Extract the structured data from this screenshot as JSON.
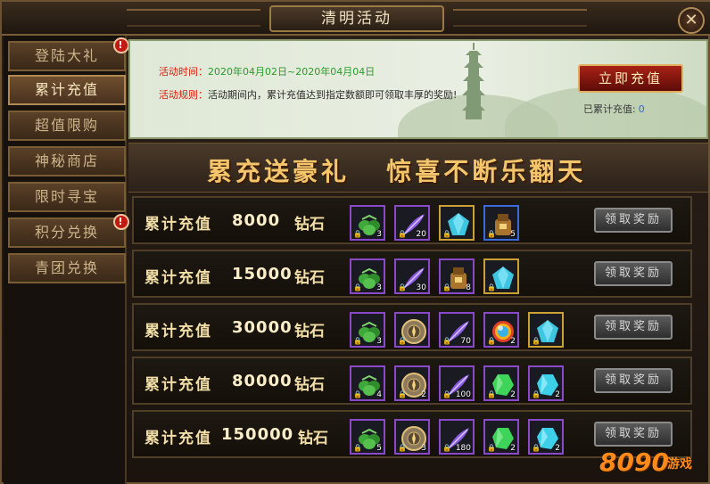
{
  "window": {
    "title": "清明活动",
    "close_label": "✕"
  },
  "sidebar": {
    "tabs": [
      {
        "label": "登陆大礼",
        "alert": "!"
      },
      {
        "label": "累计充值",
        "active": true
      },
      {
        "label": "超值限购"
      },
      {
        "label": "神秘商店"
      },
      {
        "label": "限时寻宝"
      },
      {
        "label": "积分兑换",
        "alert": "!"
      },
      {
        "label": "青团兑换"
      }
    ]
  },
  "banner": {
    "time_label": "活动时间：",
    "time_value": "2020年04月02日~2020年04月04日",
    "rule_label": "活动规则：",
    "rule_value": "活动期间内，累计充值达到指定数额即可领取丰厚的奖励!",
    "recharge_button": "立即充值",
    "total_label": "已累计充值:",
    "total_value": "0"
  },
  "slogan": "累充送豪礼   惊喜不断乐翻天",
  "rewards": [
    {
      "label": "累计充值",
      "amount": "8000",
      "unit": "钻石",
      "claim": "领取奖励",
      "items": [
        {
          "icon": "green-dumpling-icon",
          "count": "3",
          "frame": "purple"
        },
        {
          "icon": "purple-feather-icon",
          "count": "20",
          "frame": "purple"
        },
        {
          "icon": "blue-gem-icon",
          "count": "",
          "frame": "gold"
        },
        {
          "icon": "treasure-bag-icon",
          "count": "5",
          "frame": "blue"
        }
      ]
    },
    {
      "label": "累计充值",
      "amount": "15000",
      "unit": "钻石",
      "claim": "领取奖励",
      "items": [
        {
          "icon": "green-dumpling-icon",
          "count": "3",
          "frame": "purple"
        },
        {
          "icon": "purple-feather-icon",
          "count": "30",
          "frame": "purple"
        },
        {
          "icon": "treasure-bag-icon",
          "count": "8",
          "frame": "purple"
        },
        {
          "icon": "blue-gem-icon",
          "count": "",
          "frame": "gold"
        }
      ]
    },
    {
      "label": "累计充值",
      "amount": "30000",
      "unit": "钻石",
      "claim": "领取奖励",
      "items": [
        {
          "icon": "green-dumpling-icon",
          "count": "3",
          "frame": "purple"
        },
        {
          "icon": "compass-disc-icon",
          "count": "",
          "frame": "purple"
        },
        {
          "icon": "purple-feather-icon",
          "count": "70",
          "frame": "purple"
        },
        {
          "icon": "rainbow-orb-icon",
          "count": "2",
          "frame": "purple"
        },
        {
          "icon": "blue-gem-icon",
          "count": "",
          "frame": "gold"
        }
      ]
    },
    {
      "label": "累计充值",
      "amount": "80000",
      "unit": "钻石",
      "claim": "领取奖励",
      "items": [
        {
          "icon": "green-dumpling-icon",
          "count": "4",
          "frame": "purple"
        },
        {
          "icon": "compass-disc-icon",
          "count": "2",
          "frame": "purple"
        },
        {
          "icon": "purple-feather-icon",
          "count": "100",
          "frame": "purple"
        },
        {
          "icon": "green-crystal-icon",
          "count": "2",
          "frame": "purple"
        },
        {
          "icon": "cyan-crystal-icon",
          "count": "2",
          "frame": "purple"
        }
      ]
    },
    {
      "label": "累计充值",
      "amount": "150000",
      "unit": "钻石",
      "claim": "领取奖励",
      "items": [
        {
          "icon": "green-dumpling-icon",
          "count": "5",
          "frame": "purple"
        },
        {
          "icon": "compass-disc-icon",
          "count": "3",
          "frame": "purple"
        },
        {
          "icon": "purple-feather-icon",
          "count": "180",
          "frame": "purple"
        },
        {
          "icon": "green-crystal-icon",
          "count": "2",
          "frame": "purple"
        },
        {
          "icon": "cyan-crystal-icon",
          "count": "2",
          "frame": "purple"
        }
      ]
    }
  ],
  "watermark": {
    "number": "8090",
    "text": "游戏"
  },
  "colors": {
    "accent_gold": "#f4c56a",
    "time_green": "#2a9a2a",
    "label_red": "#d81c0c",
    "button_red": "#a82216"
  }
}
